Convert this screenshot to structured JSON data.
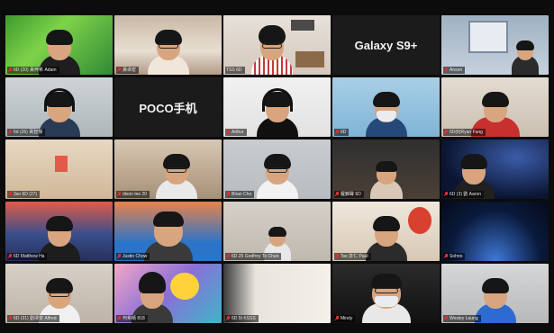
{
  "participants": [
    {
      "name": "6D (20) 黃梓希 Adam",
      "muted": true
    },
    {
      "name": "黃卓宏",
      "muted": true
    },
    {
      "name": "TSS 6D",
      "muted": false
    },
    {
      "name": "",
      "muted": false,
      "display": "Galaxy S9+"
    },
    {
      "name": "Anson",
      "muted": true
    },
    {
      "name": "6d (26) 黃智傑",
      "muted": true
    },
    {
      "name": "",
      "muted": false,
      "display": "POCO手机"
    },
    {
      "name": "Arthur",
      "muted": true
    },
    {
      "name": "6D",
      "muted": true
    },
    {
      "name": "6D(8)Ryan Fung",
      "muted": true
    },
    {
      "name": "3so 6D (27)",
      "muted": true
    },
    {
      "name": "dixon lee 20",
      "muted": true
    },
    {
      "name": "Brian Cho",
      "muted": true
    },
    {
      "name": "羅錦聲 6D",
      "muted": true
    },
    {
      "name": "6D (3) 劉 Aaron",
      "muted": true
    },
    {
      "name": "6D Matthew Ha",
      "muted": true
    },
    {
      "name": "Justin Chow",
      "muted": true
    },
    {
      "name": "6D 25 Godfrey To Chun",
      "muted": true
    },
    {
      "name": "Tse 許仁 Paul",
      "muted": true
    },
    {
      "name": "Sohno",
      "muted": true
    },
    {
      "name": "6D (31) 劉澤安 Alfred",
      "muted": true
    },
    {
      "name": "何希晴 818",
      "muted": true
    },
    {
      "name": "6D 5t KSSS",
      "muted": true
    },
    {
      "name": "",
      "muted": false
    },
    {
      "name": "Wesley Leung",
      "muted": true
    },
    {
      "name": "Wesley Leung",
      "muted": true
    }
  ],
  "visible_labels": {
    "row3_col3_label": "Mission",
    "row5_col4_label": "Mindy"
  },
  "colors": {
    "active_speaker_border": "#d8d800",
    "muted_mic": "#e03131",
    "background": "#0c0c0c"
  }
}
